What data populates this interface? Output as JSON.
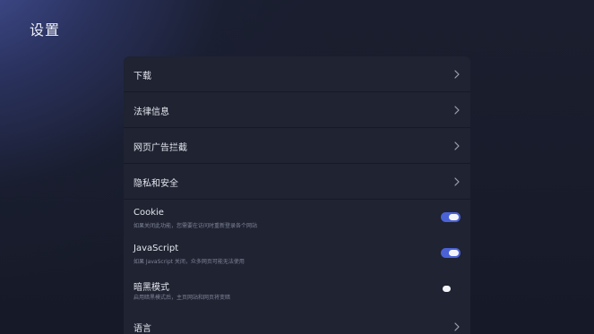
{
  "header": {
    "title": "设置"
  },
  "settings": {
    "items": [
      {
        "label": "下载",
        "type": "link"
      },
      {
        "label": "法律信息",
        "type": "link"
      },
      {
        "label": "网页广告拦截",
        "type": "link"
      },
      {
        "label": "隐私和安全",
        "type": "link"
      },
      {
        "label": "Cookie",
        "sublabel": "如果关闭此功能，您需要在访问时重新登录各个网站",
        "type": "toggle",
        "checked": true
      },
      {
        "label": "JavaScript",
        "sublabel": "如果 JavaScript 关闭，众多网页可能无法使用",
        "type": "toggle",
        "checked": true
      },
      {
        "label": "暗黑模式",
        "sublabel": "启用暗黑模式后，主页网站和网页将变暗",
        "type": "toggle",
        "checked": false
      },
      {
        "label": "语言",
        "type": "link"
      }
    ]
  },
  "icons": {
    "link_arrow": "chevron-right-icon"
  },
  "colors": {
    "accent": "#4a62d6",
    "panel": "#1f2332",
    "background": "#161a28"
  }
}
